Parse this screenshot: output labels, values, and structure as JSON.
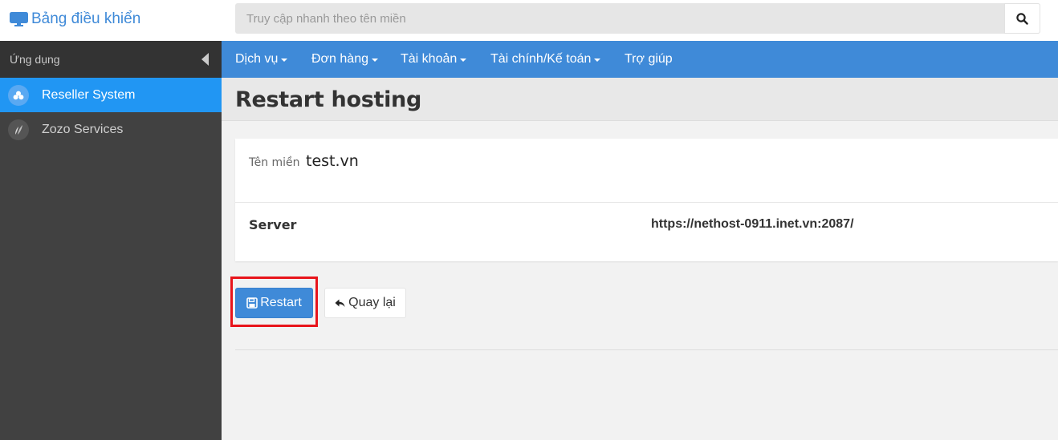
{
  "header": {
    "brand": "Bảng điều khiển",
    "brand_icon": "monitor-icon",
    "search_placeholder": "Truy cập nhanh theo tên miền",
    "search_icon": "search-icon"
  },
  "sidebar": {
    "title": "Ứng dụng",
    "items": [
      {
        "label": "Reseller System",
        "icon": "reseller-logo-icon",
        "active": true
      },
      {
        "label": "Zozo Services",
        "icon": "zozo-logo-icon",
        "active": false
      }
    ]
  },
  "navbar": {
    "items": [
      {
        "label": "Dịch vụ",
        "dropdown": true
      },
      {
        "label": "Đơn hàng",
        "dropdown": true
      },
      {
        "label": "Tài khoản",
        "dropdown": true
      },
      {
        "label": "Tài chính/Kế toán",
        "dropdown": true
      },
      {
        "label": "Trợ giúp",
        "dropdown": false
      }
    ]
  },
  "page": {
    "title": "Restart hosting"
  },
  "detail": {
    "domain_label": "Tên miền",
    "domain_value": "test.vn",
    "server_label": "Server",
    "server_value": "https://nethost-0911.inet.vn:2087/"
  },
  "actions": {
    "restart_label": "Restart",
    "restart_icon": "save-icon",
    "back_label": "Quay lại",
    "back_icon": "reply-arrow-icon"
  },
  "colors": {
    "accent": "#3f8ad8",
    "sidebar_active": "#2196f3",
    "sidebar_bg": "#414141",
    "highlight": "#e8141b"
  }
}
